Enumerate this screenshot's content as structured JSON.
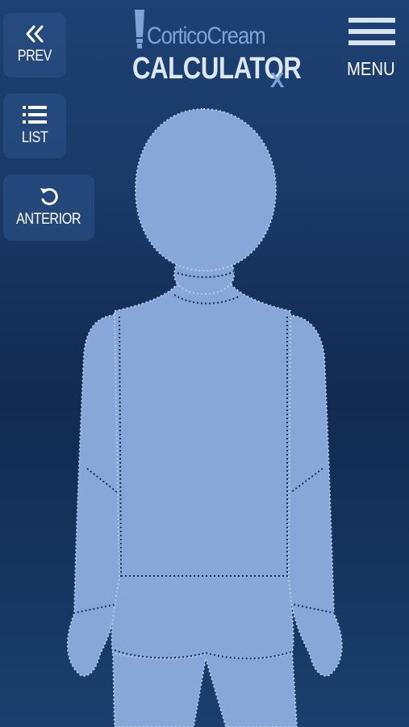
{
  "header": {
    "logo_top": "CorticoCream",
    "logo_main": "CALCULATOR",
    "logo_suffix": "X",
    "menu_label": "MENU"
  },
  "nav": {
    "prev_label": "PREV",
    "list_label": "LIST",
    "view_label": "ANTERIOR"
  },
  "colors": {
    "background": "#112a50",
    "panel": "#284e82",
    "figure_fill": "#86a7d8",
    "logo_accent": "#7ea3d8"
  },
  "icons": {
    "prev": "double-chevron-left-icon",
    "list": "list-icon",
    "rotate": "rotate-icon",
    "menu": "hamburger-icon"
  }
}
